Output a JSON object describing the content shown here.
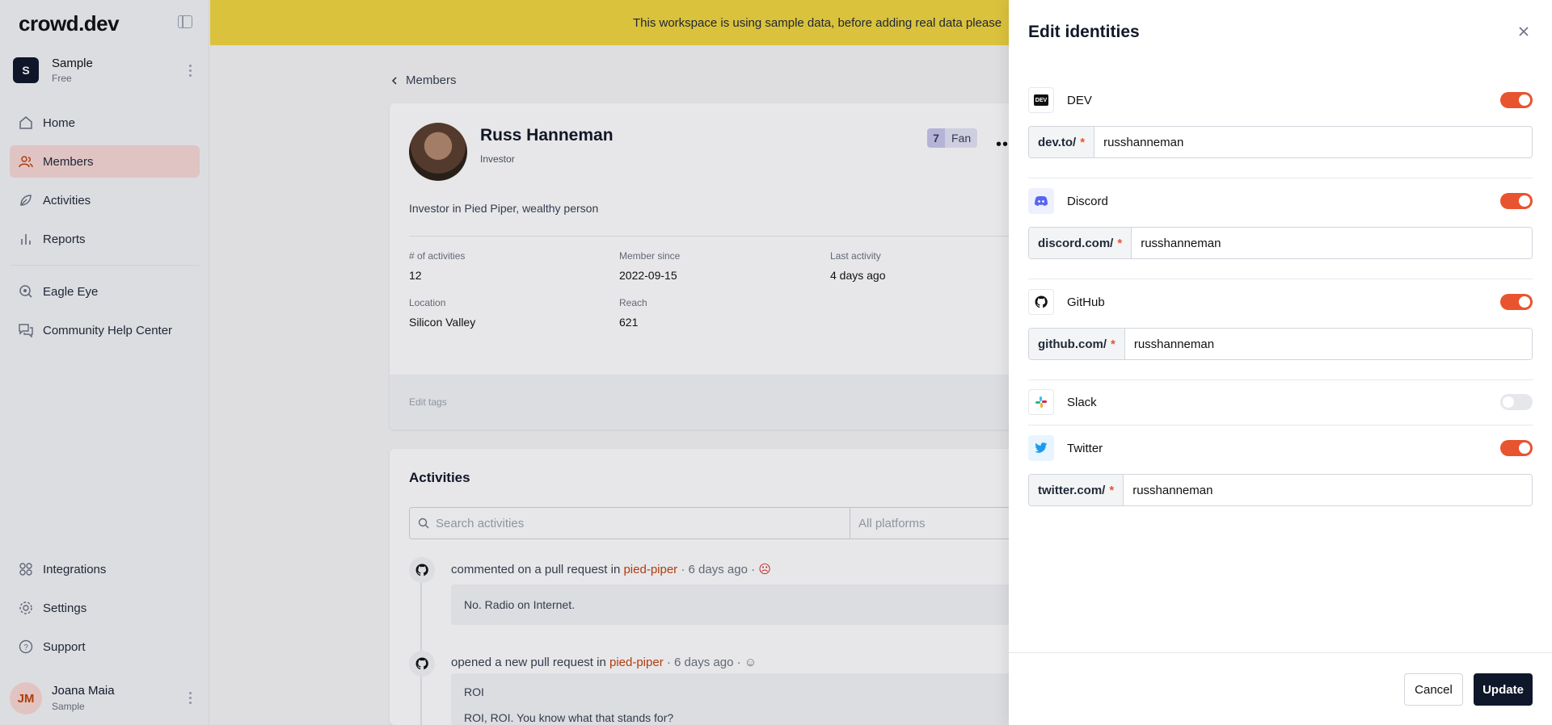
{
  "sidebar": {
    "logo": "crowd.dev",
    "workspace": {
      "initial": "S",
      "name": "Sample",
      "plan": "Free"
    },
    "nav": [
      {
        "label": "Home",
        "icon": "home-icon"
      },
      {
        "label": "Members",
        "icon": "members-icon",
        "active": true
      },
      {
        "label": "Activities",
        "icon": "activities-icon"
      },
      {
        "label": "Reports",
        "icon": "reports-icon"
      },
      {
        "label": "Eagle Eye",
        "icon": "eagle-eye-icon"
      },
      {
        "label": "Community Help Center",
        "icon": "help-center-icon"
      }
    ],
    "bottom_nav": [
      {
        "label": "Integrations",
        "icon": "integrations-icon"
      },
      {
        "label": "Settings",
        "icon": "settings-icon"
      },
      {
        "label": "Support",
        "icon": "support-icon"
      }
    ],
    "user": {
      "initials": "JM",
      "name": "Joana Maia",
      "workspace": "Sample"
    }
  },
  "banner": {
    "text": "This workspace is using sample data, before adding real data please"
  },
  "breadcrumb": {
    "back_label": "Members"
  },
  "member": {
    "name": "Russ Hanneman",
    "title": "Investor",
    "engagement_level": "7",
    "engagement_label": "Fan",
    "bio": "Investor in Pied Piper, wealthy person",
    "stats": {
      "activities_label": "# of activities",
      "activities_value": "12",
      "since_label": "Member since",
      "since_value": "2022-09-15",
      "last_label": "Last activity",
      "last_value": "4 days ago",
      "location_label": "Location",
      "location_value": "Silicon Valley",
      "reach_label": "Reach",
      "reach_value": "621"
    },
    "tags_placeholder": "Edit tags"
  },
  "activities": {
    "title": "Activities",
    "search_placeholder": "Search activities",
    "platform_filter": "All platforms",
    "items": [
      {
        "action": "commented on a pull request in",
        "repo": "pied-piper",
        "time": "· 6 days ago ·",
        "sentiment": "☹",
        "body": [
          "No. Radio on Internet."
        ]
      },
      {
        "action": "opened a new pull request in",
        "repo": "pied-piper",
        "time": "· 6 days ago ·",
        "sentiment": "☺",
        "body": [
          "ROI",
          "ROI, ROI. You know what that stands for?"
        ]
      }
    ]
  },
  "drawer": {
    "title": "Edit identities",
    "identities": [
      {
        "platform": "DEV",
        "prefix": "dev.to/",
        "required": "*",
        "username": "russhanneman",
        "enabled": true,
        "icon": "dev-icon"
      },
      {
        "platform": "Discord",
        "prefix": "discord.com/",
        "required": "*",
        "username": "russhanneman",
        "enabled": true,
        "icon": "discord-icon"
      },
      {
        "platform": "GitHub",
        "prefix": "github.com/",
        "required": "*",
        "username": "russhanneman",
        "enabled": true,
        "icon": "github-icon"
      },
      {
        "platform": "Slack",
        "enabled": false,
        "icon": "slack-icon"
      },
      {
        "platform": "Twitter",
        "prefix": "twitter.com/",
        "required": "*",
        "username": "russhanneman",
        "enabled": true,
        "icon": "twitter-icon"
      }
    ],
    "cancel_label": "Cancel",
    "update_label": "Update"
  },
  "colors": {
    "accent": "#e8542f",
    "banner": "#f2d63f",
    "dark": "#0f172a",
    "active_nav": "#f7d9d5"
  }
}
